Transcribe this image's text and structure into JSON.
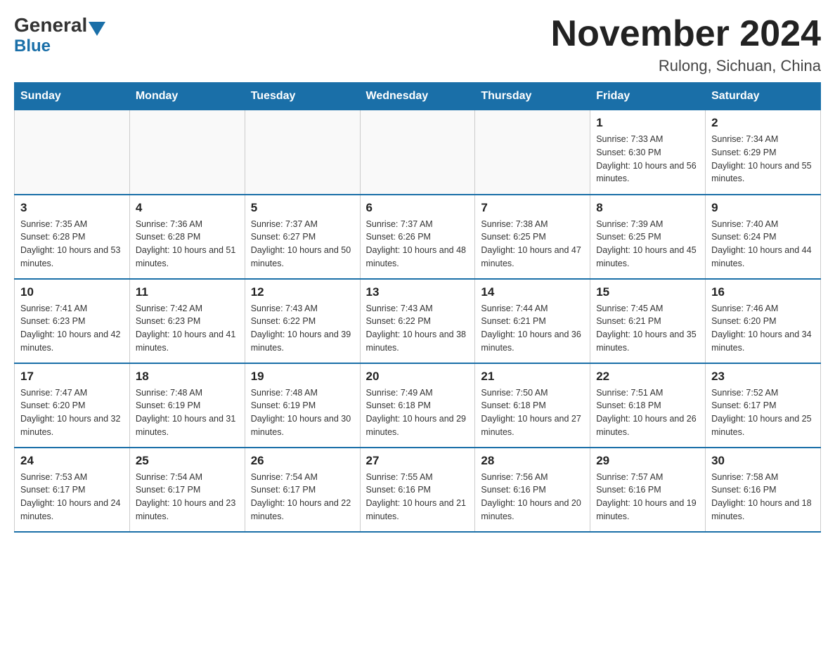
{
  "logo": {
    "general": "General",
    "blue": "Blue"
  },
  "title": {
    "month_year": "November 2024",
    "location": "Rulong, Sichuan, China"
  },
  "days_of_week": [
    "Sunday",
    "Monday",
    "Tuesday",
    "Wednesday",
    "Thursday",
    "Friday",
    "Saturday"
  ],
  "weeks": [
    [
      {
        "day": "",
        "info": ""
      },
      {
        "day": "",
        "info": ""
      },
      {
        "day": "",
        "info": ""
      },
      {
        "day": "",
        "info": ""
      },
      {
        "day": "",
        "info": ""
      },
      {
        "day": "1",
        "info": "Sunrise: 7:33 AM\nSunset: 6:30 PM\nDaylight: 10 hours and 56 minutes."
      },
      {
        "day": "2",
        "info": "Sunrise: 7:34 AM\nSunset: 6:29 PM\nDaylight: 10 hours and 55 minutes."
      }
    ],
    [
      {
        "day": "3",
        "info": "Sunrise: 7:35 AM\nSunset: 6:28 PM\nDaylight: 10 hours and 53 minutes."
      },
      {
        "day": "4",
        "info": "Sunrise: 7:36 AM\nSunset: 6:28 PM\nDaylight: 10 hours and 51 minutes."
      },
      {
        "day": "5",
        "info": "Sunrise: 7:37 AM\nSunset: 6:27 PM\nDaylight: 10 hours and 50 minutes."
      },
      {
        "day": "6",
        "info": "Sunrise: 7:37 AM\nSunset: 6:26 PM\nDaylight: 10 hours and 48 minutes."
      },
      {
        "day": "7",
        "info": "Sunrise: 7:38 AM\nSunset: 6:25 PM\nDaylight: 10 hours and 47 minutes."
      },
      {
        "day": "8",
        "info": "Sunrise: 7:39 AM\nSunset: 6:25 PM\nDaylight: 10 hours and 45 minutes."
      },
      {
        "day": "9",
        "info": "Sunrise: 7:40 AM\nSunset: 6:24 PM\nDaylight: 10 hours and 44 minutes."
      }
    ],
    [
      {
        "day": "10",
        "info": "Sunrise: 7:41 AM\nSunset: 6:23 PM\nDaylight: 10 hours and 42 minutes."
      },
      {
        "day": "11",
        "info": "Sunrise: 7:42 AM\nSunset: 6:23 PM\nDaylight: 10 hours and 41 minutes."
      },
      {
        "day": "12",
        "info": "Sunrise: 7:43 AM\nSunset: 6:22 PM\nDaylight: 10 hours and 39 minutes."
      },
      {
        "day": "13",
        "info": "Sunrise: 7:43 AM\nSunset: 6:22 PM\nDaylight: 10 hours and 38 minutes."
      },
      {
        "day": "14",
        "info": "Sunrise: 7:44 AM\nSunset: 6:21 PM\nDaylight: 10 hours and 36 minutes."
      },
      {
        "day": "15",
        "info": "Sunrise: 7:45 AM\nSunset: 6:21 PM\nDaylight: 10 hours and 35 minutes."
      },
      {
        "day": "16",
        "info": "Sunrise: 7:46 AM\nSunset: 6:20 PM\nDaylight: 10 hours and 34 minutes."
      }
    ],
    [
      {
        "day": "17",
        "info": "Sunrise: 7:47 AM\nSunset: 6:20 PM\nDaylight: 10 hours and 32 minutes."
      },
      {
        "day": "18",
        "info": "Sunrise: 7:48 AM\nSunset: 6:19 PM\nDaylight: 10 hours and 31 minutes."
      },
      {
        "day": "19",
        "info": "Sunrise: 7:48 AM\nSunset: 6:19 PM\nDaylight: 10 hours and 30 minutes."
      },
      {
        "day": "20",
        "info": "Sunrise: 7:49 AM\nSunset: 6:18 PM\nDaylight: 10 hours and 29 minutes."
      },
      {
        "day": "21",
        "info": "Sunrise: 7:50 AM\nSunset: 6:18 PM\nDaylight: 10 hours and 27 minutes."
      },
      {
        "day": "22",
        "info": "Sunrise: 7:51 AM\nSunset: 6:18 PM\nDaylight: 10 hours and 26 minutes."
      },
      {
        "day": "23",
        "info": "Sunrise: 7:52 AM\nSunset: 6:17 PM\nDaylight: 10 hours and 25 minutes."
      }
    ],
    [
      {
        "day": "24",
        "info": "Sunrise: 7:53 AM\nSunset: 6:17 PM\nDaylight: 10 hours and 24 minutes."
      },
      {
        "day": "25",
        "info": "Sunrise: 7:54 AM\nSunset: 6:17 PM\nDaylight: 10 hours and 23 minutes."
      },
      {
        "day": "26",
        "info": "Sunrise: 7:54 AM\nSunset: 6:17 PM\nDaylight: 10 hours and 22 minutes."
      },
      {
        "day": "27",
        "info": "Sunrise: 7:55 AM\nSunset: 6:16 PM\nDaylight: 10 hours and 21 minutes."
      },
      {
        "day": "28",
        "info": "Sunrise: 7:56 AM\nSunset: 6:16 PM\nDaylight: 10 hours and 20 minutes."
      },
      {
        "day": "29",
        "info": "Sunrise: 7:57 AM\nSunset: 6:16 PM\nDaylight: 10 hours and 19 minutes."
      },
      {
        "day": "30",
        "info": "Sunrise: 7:58 AM\nSunset: 6:16 PM\nDaylight: 10 hours and 18 minutes."
      }
    ]
  ]
}
